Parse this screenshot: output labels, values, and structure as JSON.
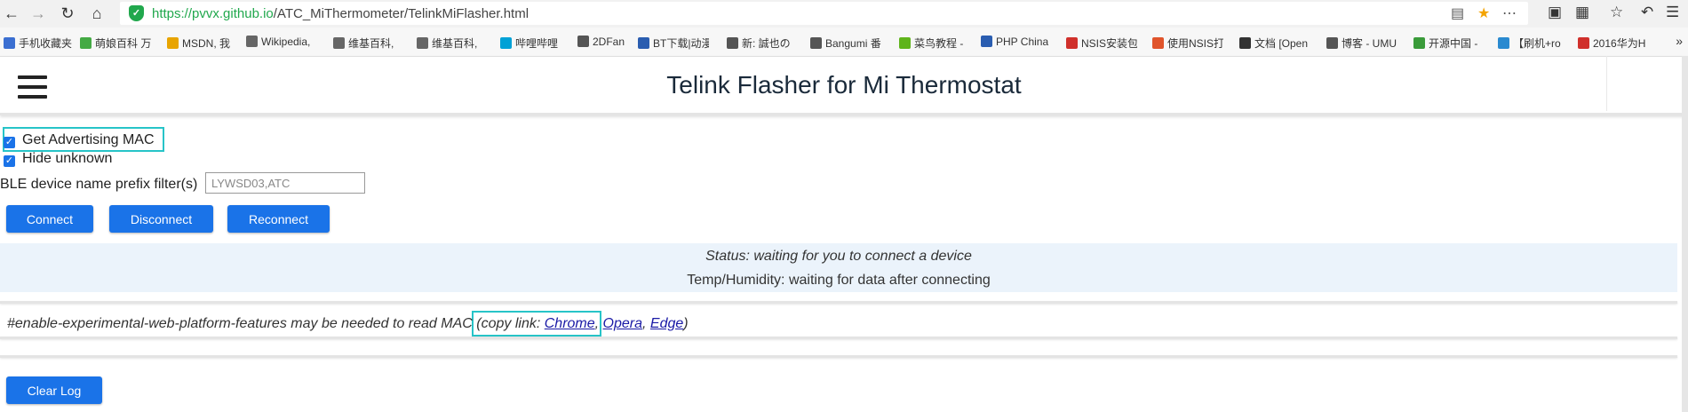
{
  "browser": {
    "url_protocol": "https://",
    "url_domain": "pvvx.github.io",
    "url_path": "/ATC_MiThermometer/TelinkMiFlasher.html",
    "bookmarks": [
      {
        "label": "手机收藏夹",
        "color": "#3b6fd1"
      },
      {
        "label": "萌娘百科 万",
        "color": "#44aa44"
      },
      {
        "label": "MSDN, 我",
        "color": "#e8a400"
      },
      {
        "label": "Wikipedia,",
        "color": "#666666"
      },
      {
        "label": "维基百科,",
        "color": "#666666"
      },
      {
        "label": "维基百科,",
        "color": "#666666"
      },
      {
        "label": "哔哩哔哩",
        "color": "#00a1d6"
      },
      {
        "label": "2DFan",
        "color": "#555555"
      },
      {
        "label": "BT下载|动漫",
        "color": "#2a5db0"
      },
      {
        "label": "新: 誠也の",
        "color": "#555555"
      },
      {
        "label": "Bangumi 番",
        "color": "#555555"
      },
      {
        "label": "菜鸟教程 -",
        "color": "#5fb41b"
      },
      {
        "label": "PHP China",
        "color": "#2a5db0"
      },
      {
        "label": "NSIS安装包",
        "color": "#d0302b"
      },
      {
        "label": "使用NSIS打",
        "color": "#e0542b"
      },
      {
        "label": "文档 [Open",
        "color": "#333333"
      },
      {
        "label": "博客 - UMU",
        "color": "#555555"
      },
      {
        "label": "开源中国 -",
        "color": "#3a9b3a"
      },
      {
        "label": "【刷机+ro",
        "color": "#2a8ad0"
      },
      {
        "label": "2016华为H",
        "color": "#d0302b"
      }
    ],
    "bookmarks_more": "»"
  },
  "page": {
    "title": "Telink Flasher for Mi Thermostat",
    "option_adv_mac": "Get Advertising MAC",
    "option_hide_unknown": "Hide unknown",
    "filter_label": "BLE device name prefix filter(s)",
    "filter_placeholder": "LYWSD03,ATC",
    "connect_label": "Connect",
    "disconnect_label": "Disconnect",
    "reconnect_label": "Reconnect",
    "status": "Status: waiting for you to connect a device",
    "temp_humidity": "Temp/Humidity: waiting for data after connecting",
    "note_text": "#enable-experimental-web-platform-features may be needed to read MAC",
    "note_copy": "(copy link: ",
    "link_chrome": "Chrome",
    "link_opera": "Opera",
    "link_edge": "Edge",
    "note_end": ")",
    "clear_log_label": "Clear Log"
  },
  "colors": {
    "accent": "#1a73e8",
    "highlight": "#27c4c8",
    "status_bg": "#ebf3fb"
  }
}
